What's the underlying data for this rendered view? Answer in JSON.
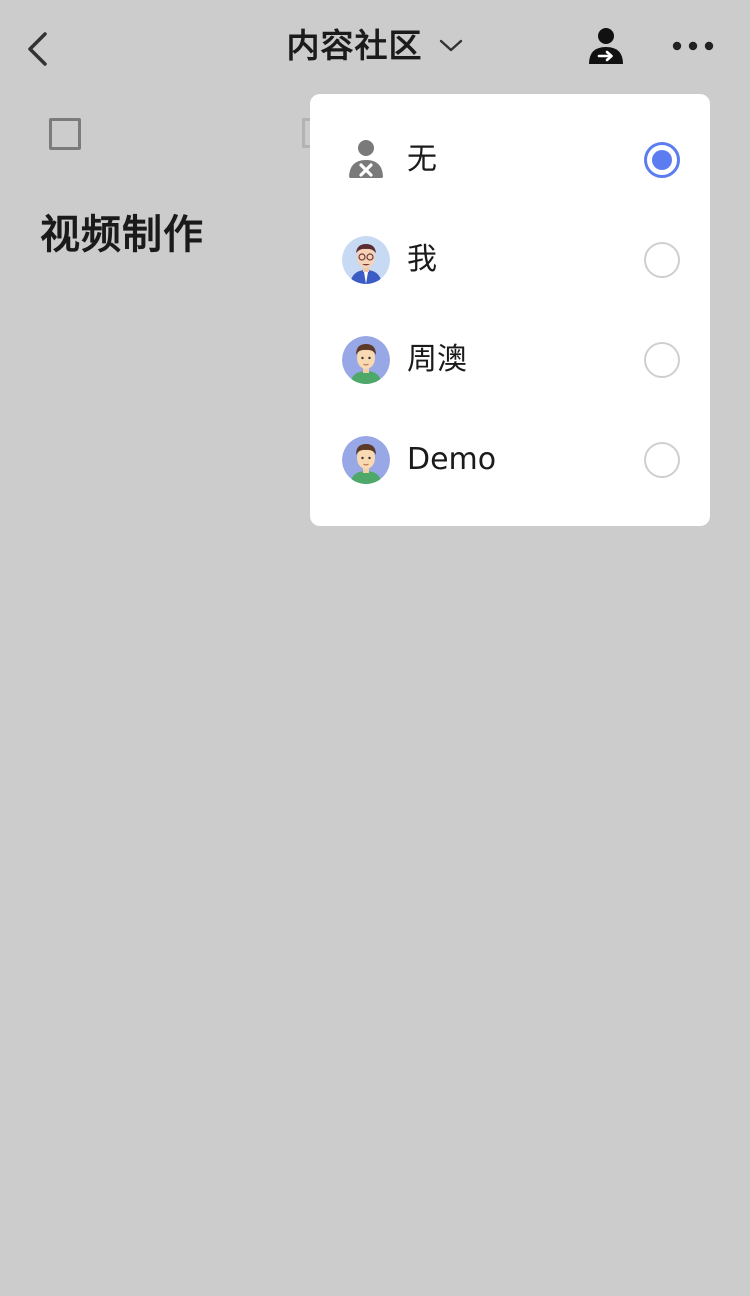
{
  "nav": {
    "title": "内容社区",
    "back_icon": "chevron-left-icon",
    "title_dropdown_icon": "chevron-down-icon",
    "assign_icon": "user-transfer-icon",
    "more_icon": "more-dots-icon"
  },
  "task": {
    "title": "视频制作"
  },
  "assignee_menu": {
    "options": [
      {
        "label": "无",
        "icon": "no-assignee-icon",
        "selected": true
      },
      {
        "label": "我",
        "icon": "avatar-me",
        "selected": false
      },
      {
        "label": "周澳",
        "icon": "avatar-zhouao",
        "selected": false
      },
      {
        "label": "Demo",
        "icon": "avatar-demo",
        "selected": false
      }
    ]
  },
  "colors": {
    "background_overlay": "#cccccc",
    "menu_background": "#ffffff",
    "accent": "#5b7df0",
    "radio_border": "#cfcfcf",
    "text": "#1b1b1b"
  }
}
